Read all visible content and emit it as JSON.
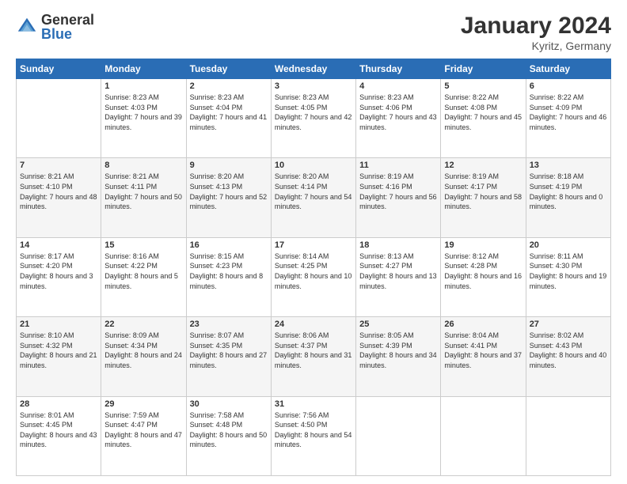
{
  "logo": {
    "general": "General",
    "blue": "Blue"
  },
  "title": "January 2024",
  "location": "Kyritz, Germany",
  "weekdays": [
    "Sunday",
    "Monday",
    "Tuesday",
    "Wednesday",
    "Thursday",
    "Friday",
    "Saturday"
  ],
  "weeks": [
    [
      {
        "day": "",
        "sunrise": "",
        "sunset": "",
        "daylight": ""
      },
      {
        "day": "1",
        "sunrise": "Sunrise: 8:23 AM",
        "sunset": "Sunset: 4:03 PM",
        "daylight": "Daylight: 7 hours and 39 minutes."
      },
      {
        "day": "2",
        "sunrise": "Sunrise: 8:23 AM",
        "sunset": "Sunset: 4:04 PM",
        "daylight": "Daylight: 7 hours and 41 minutes."
      },
      {
        "day": "3",
        "sunrise": "Sunrise: 8:23 AM",
        "sunset": "Sunset: 4:05 PM",
        "daylight": "Daylight: 7 hours and 42 minutes."
      },
      {
        "day": "4",
        "sunrise": "Sunrise: 8:23 AM",
        "sunset": "Sunset: 4:06 PM",
        "daylight": "Daylight: 7 hours and 43 minutes."
      },
      {
        "day": "5",
        "sunrise": "Sunrise: 8:22 AM",
        "sunset": "Sunset: 4:08 PM",
        "daylight": "Daylight: 7 hours and 45 minutes."
      },
      {
        "day": "6",
        "sunrise": "Sunrise: 8:22 AM",
        "sunset": "Sunset: 4:09 PM",
        "daylight": "Daylight: 7 hours and 46 minutes."
      }
    ],
    [
      {
        "day": "7",
        "sunrise": "Sunrise: 8:21 AM",
        "sunset": "Sunset: 4:10 PM",
        "daylight": "Daylight: 7 hours and 48 minutes."
      },
      {
        "day": "8",
        "sunrise": "Sunrise: 8:21 AM",
        "sunset": "Sunset: 4:11 PM",
        "daylight": "Daylight: 7 hours and 50 minutes."
      },
      {
        "day": "9",
        "sunrise": "Sunrise: 8:20 AM",
        "sunset": "Sunset: 4:13 PM",
        "daylight": "Daylight: 7 hours and 52 minutes."
      },
      {
        "day": "10",
        "sunrise": "Sunrise: 8:20 AM",
        "sunset": "Sunset: 4:14 PM",
        "daylight": "Daylight: 7 hours and 54 minutes."
      },
      {
        "day": "11",
        "sunrise": "Sunrise: 8:19 AM",
        "sunset": "Sunset: 4:16 PM",
        "daylight": "Daylight: 7 hours and 56 minutes."
      },
      {
        "day": "12",
        "sunrise": "Sunrise: 8:19 AM",
        "sunset": "Sunset: 4:17 PM",
        "daylight": "Daylight: 7 hours and 58 minutes."
      },
      {
        "day": "13",
        "sunrise": "Sunrise: 8:18 AM",
        "sunset": "Sunset: 4:19 PM",
        "daylight": "Daylight: 8 hours and 0 minutes."
      }
    ],
    [
      {
        "day": "14",
        "sunrise": "Sunrise: 8:17 AM",
        "sunset": "Sunset: 4:20 PM",
        "daylight": "Daylight: 8 hours and 3 minutes."
      },
      {
        "day": "15",
        "sunrise": "Sunrise: 8:16 AM",
        "sunset": "Sunset: 4:22 PM",
        "daylight": "Daylight: 8 hours and 5 minutes."
      },
      {
        "day": "16",
        "sunrise": "Sunrise: 8:15 AM",
        "sunset": "Sunset: 4:23 PM",
        "daylight": "Daylight: 8 hours and 8 minutes."
      },
      {
        "day": "17",
        "sunrise": "Sunrise: 8:14 AM",
        "sunset": "Sunset: 4:25 PM",
        "daylight": "Daylight: 8 hours and 10 minutes."
      },
      {
        "day": "18",
        "sunrise": "Sunrise: 8:13 AM",
        "sunset": "Sunset: 4:27 PM",
        "daylight": "Daylight: 8 hours and 13 minutes."
      },
      {
        "day": "19",
        "sunrise": "Sunrise: 8:12 AM",
        "sunset": "Sunset: 4:28 PM",
        "daylight": "Daylight: 8 hours and 16 minutes."
      },
      {
        "day": "20",
        "sunrise": "Sunrise: 8:11 AM",
        "sunset": "Sunset: 4:30 PM",
        "daylight": "Daylight: 8 hours and 19 minutes."
      }
    ],
    [
      {
        "day": "21",
        "sunrise": "Sunrise: 8:10 AM",
        "sunset": "Sunset: 4:32 PM",
        "daylight": "Daylight: 8 hours and 21 minutes."
      },
      {
        "day": "22",
        "sunrise": "Sunrise: 8:09 AM",
        "sunset": "Sunset: 4:34 PM",
        "daylight": "Daylight: 8 hours and 24 minutes."
      },
      {
        "day": "23",
        "sunrise": "Sunrise: 8:07 AM",
        "sunset": "Sunset: 4:35 PM",
        "daylight": "Daylight: 8 hours and 27 minutes."
      },
      {
        "day": "24",
        "sunrise": "Sunrise: 8:06 AM",
        "sunset": "Sunset: 4:37 PM",
        "daylight": "Daylight: 8 hours and 31 minutes."
      },
      {
        "day": "25",
        "sunrise": "Sunrise: 8:05 AM",
        "sunset": "Sunset: 4:39 PM",
        "daylight": "Daylight: 8 hours and 34 minutes."
      },
      {
        "day": "26",
        "sunrise": "Sunrise: 8:04 AM",
        "sunset": "Sunset: 4:41 PM",
        "daylight": "Daylight: 8 hours and 37 minutes."
      },
      {
        "day": "27",
        "sunrise": "Sunrise: 8:02 AM",
        "sunset": "Sunset: 4:43 PM",
        "daylight": "Daylight: 8 hours and 40 minutes."
      }
    ],
    [
      {
        "day": "28",
        "sunrise": "Sunrise: 8:01 AM",
        "sunset": "Sunset: 4:45 PM",
        "daylight": "Daylight: 8 hours and 43 minutes."
      },
      {
        "day": "29",
        "sunrise": "Sunrise: 7:59 AM",
        "sunset": "Sunset: 4:47 PM",
        "daylight": "Daylight: 8 hours and 47 minutes."
      },
      {
        "day": "30",
        "sunrise": "Sunrise: 7:58 AM",
        "sunset": "Sunset: 4:48 PM",
        "daylight": "Daylight: 8 hours and 50 minutes."
      },
      {
        "day": "31",
        "sunrise": "Sunrise: 7:56 AM",
        "sunset": "Sunset: 4:50 PM",
        "daylight": "Daylight: 8 hours and 54 minutes."
      },
      {
        "day": "",
        "sunrise": "",
        "sunset": "",
        "daylight": ""
      },
      {
        "day": "",
        "sunrise": "",
        "sunset": "",
        "daylight": ""
      },
      {
        "day": "",
        "sunrise": "",
        "sunset": "",
        "daylight": ""
      }
    ]
  ]
}
